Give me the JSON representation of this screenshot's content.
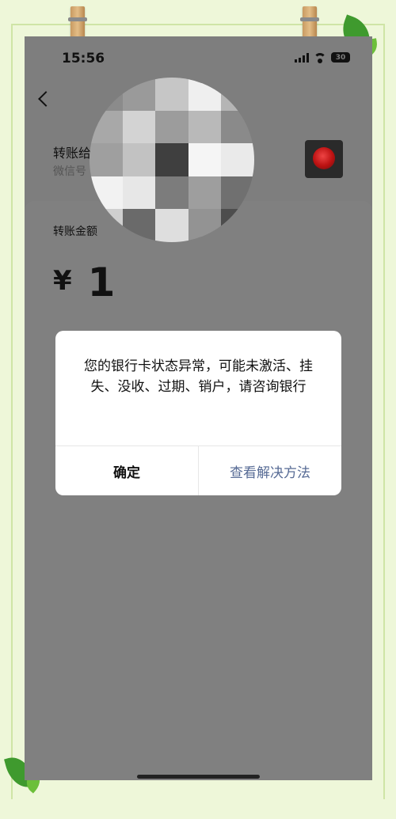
{
  "status_bar": {
    "time": "15:56",
    "battery": "30"
  },
  "payee": {
    "name": "转账给",
    "wechat_id_label": "微信号"
  },
  "transfer": {
    "amount_label": "转账金额",
    "currency_symbol": "¥",
    "amount": "1"
  },
  "dialog": {
    "message": "您的银行卡状态异常，可能未激活、挂失、没收、过期、销户，请咨询银行",
    "confirm_label": "确定",
    "solution_label": "查看解决方法"
  },
  "colors": {
    "link_blue": "#576b95",
    "overlay_gray": "#7e7e7e",
    "frame_green": "#eef7d9"
  }
}
